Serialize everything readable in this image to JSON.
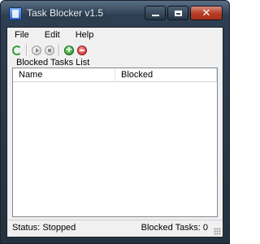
{
  "window": {
    "title": "Task Blocker v1.5",
    "minimize_glyph": "",
    "maximize_glyph": "",
    "close_glyph": "✕"
  },
  "menu": {
    "items": [
      "File",
      "Edit",
      "Help"
    ]
  },
  "toolbar": {
    "buttons": [
      "refresh-icon",
      "play-icon",
      "stop-icon",
      "add-icon",
      "remove-icon"
    ]
  },
  "list": {
    "label": "Blocked Tasks List",
    "columns": [
      "Name",
      "Blocked"
    ],
    "rows": []
  },
  "status": {
    "state_label": "Status:",
    "state_value": "Stopped",
    "count_label": "Blocked Tasks:",
    "count_value": "0"
  },
  "colors": {
    "close_button": "#b63b24",
    "add_icon": "#1e8a1e",
    "remove_icon": "#c41e1e",
    "refresh_icon": "#3a9a3a"
  }
}
